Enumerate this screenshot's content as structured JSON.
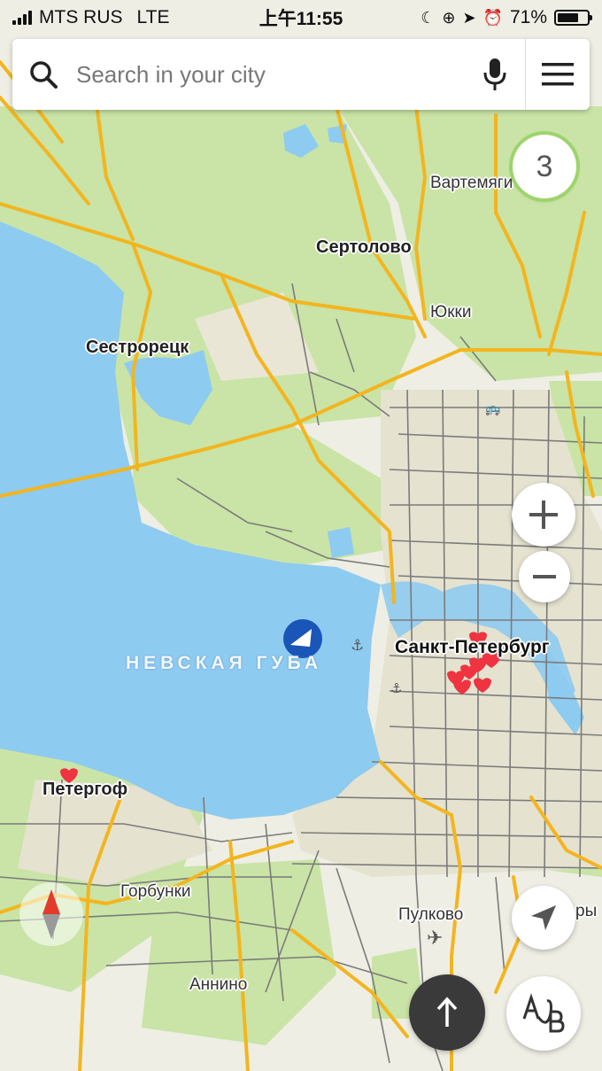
{
  "status_bar": {
    "carrier": "MTS RUS",
    "network": "LTE",
    "time": "上午11:55",
    "battery_percent": "71%",
    "battery_level": 0.71
  },
  "search": {
    "placeholder": "Search in your city",
    "icon_search": "search-icon",
    "icon_mic": "microphone-icon",
    "icon_menu": "hamburger-menu-icon"
  },
  "controls": {
    "traffic_level": "3",
    "zoom_in": "+",
    "zoom_out": "−",
    "ab_label": "AB"
  },
  "map": {
    "labels": {
      "vartemyagi": "Вартемяги",
      "sertolovo": "Сертолово",
      "yukki": "Юкки",
      "sestroretsk": "Сестрорецк",
      "nevskaya_guba": "НЕВСКАЯ ГУБА",
      "spb": "Санкт-Петербург",
      "peterhof": "Петергоф",
      "gorbunki": "Горбунки",
      "pulkovo": "Пулково",
      "annino": "Аннино",
      "edge": "ры"
    }
  },
  "colors": {
    "water": "#8ecbf0",
    "land": "#efefe4",
    "forest": "#c8e6a5",
    "road_major": "#f5b823",
    "road_minor": "#7d7d7d",
    "accent": "#1a56b8",
    "fav": "#ef3340"
  }
}
